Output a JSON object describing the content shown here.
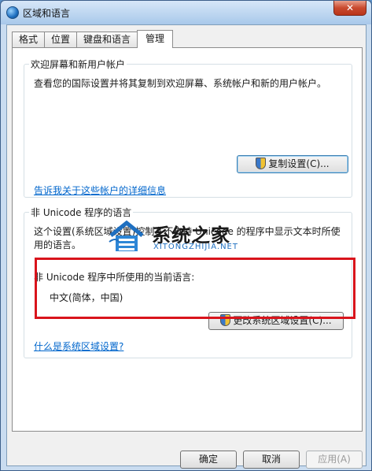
{
  "window": {
    "title": "区域和语言",
    "close_glyph": "✕"
  },
  "tabs": [
    {
      "label": "格式"
    },
    {
      "label": "位置"
    },
    {
      "label": "键盘和语言"
    },
    {
      "label": "管理"
    }
  ],
  "welcome_group": {
    "title": "欢迎屏幕和新用户帐户",
    "description": "查看您的国际设置并将其复制到欢迎屏幕、系统帐户和新的用户帐户。",
    "copy_button": "复制设置(C)...",
    "link": "告诉我关于这些帐户的详细信息"
  },
  "non_unicode_group": {
    "title": "非 Unicode 程序的语言",
    "description_line1": "这个设置(系统区域设置)控制在不支持 Unicode 的程序中显示文本时所使",
    "description_line2": "用的语言。",
    "current_label": "非 Unicode 程序中所使用的当前语言:",
    "current_value": "中文(简体，中国)",
    "change_button": "更改系统区域设置(C)...",
    "link": "什么是系统区域设置?"
  },
  "footer": {
    "ok": "确定",
    "cancel": "取消",
    "apply": "应用(A)"
  },
  "watermark": {
    "name": "系统之家",
    "url": "XITONGZHIJIA.NET"
  },
  "colors": {
    "highlight_box": "#d9141c",
    "link": "#0066cc"
  }
}
